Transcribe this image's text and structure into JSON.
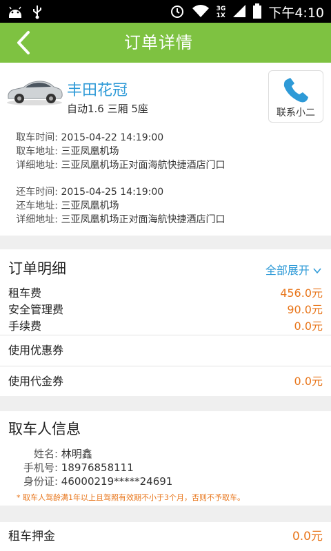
{
  "status_bar": {
    "network_top": "3G",
    "network_bottom": "1X",
    "time": "下午4:10"
  },
  "app_bar": {
    "title": "订单详情"
  },
  "car": {
    "name": "丰田花冠",
    "spec": "自动1.6  三厢  5座",
    "contact_label": "联系小二"
  },
  "pickup": {
    "time_label": "取车时间:",
    "time": "2015-04-22 14:19:00",
    "place_label": "取车地址:",
    "place": "三亚凤凰机场",
    "detail_label": "详细地址:",
    "detail": "三亚凤凰机场正对面海航快捷酒店门口"
  },
  "return": {
    "time_label": "还车时间:",
    "time": "2015-04-25 14:19:00",
    "place_label": "还车地址:",
    "place": "三亚凤凰机场",
    "detail_label": "详细地址:",
    "detail": "三亚凤凰机场正对面海航快捷酒店门口"
  },
  "order_detail": {
    "title": "订单明细",
    "expand_label": "全部展开",
    "fees": [
      {
        "label": "租车费",
        "amount": "456.0元"
      },
      {
        "label": "安全管理费",
        "amount": "90.0元"
      },
      {
        "label": "手续费",
        "amount": "0.0元"
      }
    ],
    "coupon_label": "使用优惠券",
    "voucher_label": "使用代金券",
    "voucher_amount": "0.0元"
  },
  "renter": {
    "title": "取车人信息",
    "name_label": "姓名:",
    "name": "林明鑫",
    "phone_label": "手机号:",
    "phone": "18976858111",
    "id_label": "身份证:",
    "id": "46000219*****24691",
    "notice": "* 取车人驾龄满1年以上且驾照有效期不小于3个月，否则不予取车。"
  },
  "deposit": {
    "label": "租车押金",
    "amount": "0.0元"
  },
  "colors": {
    "accent_green": "#7ec241",
    "link_blue": "#2e9ad7",
    "price_orange": "#e8751a"
  }
}
